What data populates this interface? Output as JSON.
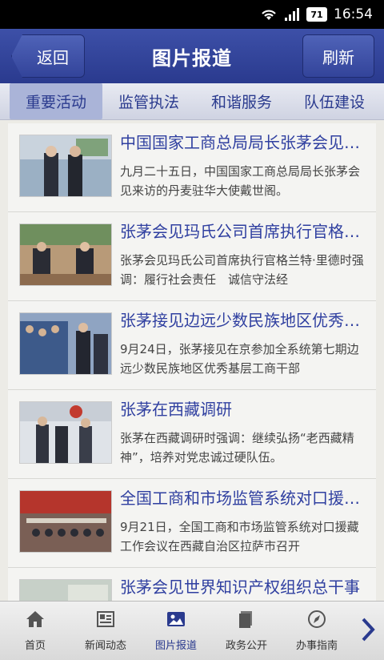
{
  "status_bar": {
    "time": "16:54",
    "battery": "71"
  },
  "header": {
    "back_label": "返回",
    "title": "图片报道",
    "refresh_label": "刷新"
  },
  "tabs": [
    {
      "label": "重要活动",
      "active": true
    },
    {
      "label": "监管执法",
      "active": false
    },
    {
      "label": "和谐服务",
      "active": false
    },
    {
      "label": "队伍建设",
      "active": false
    }
  ],
  "news": [
    {
      "title": "中国国家工商总局局长张茅会见丹麦驻华大使",
      "desc": "九月二十五日，中国国家工商总局局长张茅会见来访的丹麦驻华大使戴世阁。"
    },
    {
      "title": "张茅会见玛氏公司首席执行官格兰特·里德",
      "desc": "张茅会见玛氏公司首席执行官格兰特·里德时强调：履行社会责任　诚信守法经"
    },
    {
      "title": "张茅接见边远少数民族地区优秀基层工商干部",
      "desc": "9月24日，张茅接见在京参加全系统第七期边远少数民族地区优秀基层工商干部"
    },
    {
      "title": "张茅在西藏调研",
      "desc": "张茅在西藏调研时强调：继续弘扬“老西藏精神”，培养对党忠诚过硬队伍。"
    },
    {
      "title": "全国工商和市场监管系统对口援藏工作会议",
      "desc": "9月21日，全国工商和市场监管系统对口援藏工作会议在西藏自治区拉萨市召开"
    },
    {
      "title": "张茅会见世界知识产权组织总干事",
      "desc": ""
    }
  ],
  "bottom_nav": [
    {
      "label": "首页",
      "icon": "home-icon",
      "active": false
    },
    {
      "label": "新闻动态",
      "icon": "newspaper-icon",
      "active": false
    },
    {
      "label": "图片报道",
      "icon": "picture-icon",
      "active": true
    },
    {
      "label": "政务公开",
      "icon": "documents-icon",
      "active": false
    },
    {
      "label": "办事指南",
      "icon": "compass-icon",
      "active": false
    }
  ],
  "colors": {
    "accent": "#2a3a8e",
    "title_text": "#2f3fa0"
  }
}
